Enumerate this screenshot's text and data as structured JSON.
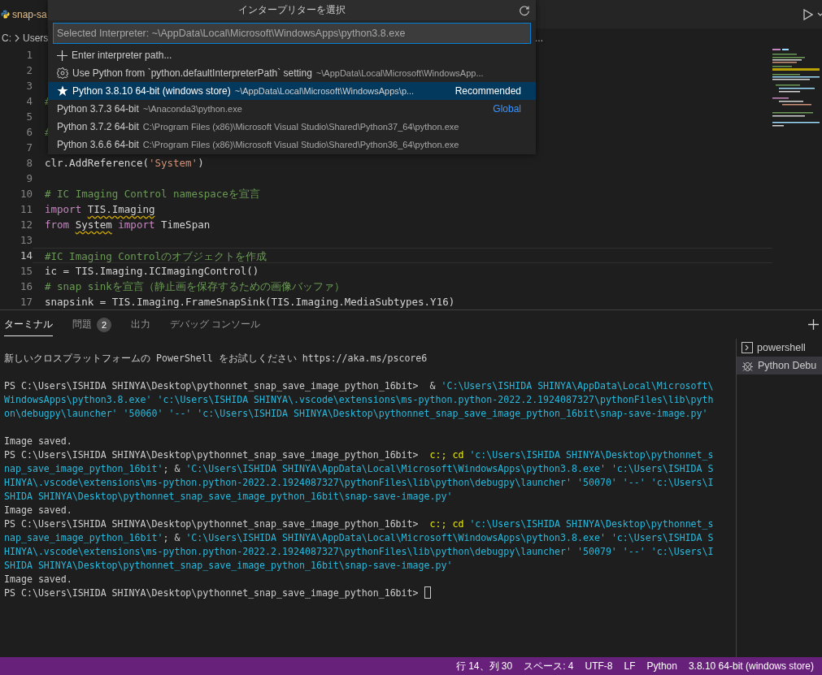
{
  "editor_tab": {
    "label": "snap-sa"
  },
  "breadcrumb": {
    "items": [
      "C:",
      "Users"
    ],
    "overflow": "..."
  },
  "code_lines": [
    {
      "number": "1",
      "current": false
    },
    {
      "number": "2",
      "current": false
    },
    {
      "number": "3",
      "current": false
    },
    {
      "number": "4",
      "current": false,
      "segments": [
        {
          "text": "#",
          "kind": "comment"
        }
      ]
    },
    {
      "number": "5",
      "current": false
    },
    {
      "number": "6",
      "current": false,
      "segments": [
        {
          "text": "#",
          "kind": "comment"
        }
      ]
    },
    {
      "number": "7",
      "current": false
    },
    {
      "number": "8",
      "current": false,
      "segments": [
        {
          "text": "clr.AddReference(",
          "kind": "plain"
        },
        {
          "text": "'System'",
          "kind": "string"
        },
        {
          "text": ")",
          "kind": "plain"
        }
      ]
    },
    {
      "number": "9",
      "current": false
    },
    {
      "number": "10",
      "current": false,
      "segments": [
        {
          "text": "# IC Imaging Control namespaceを宣言",
          "kind": "comment"
        }
      ]
    },
    {
      "number": "11",
      "current": false,
      "segments": [
        {
          "text": "import ",
          "kind": "keyword"
        },
        {
          "text": "TIS.Imaging",
          "kind": "warning"
        }
      ]
    },
    {
      "number": "12",
      "current": false,
      "segments": [
        {
          "text": "from ",
          "kind": "keyword"
        },
        {
          "text": "System",
          "kind": "warning"
        },
        {
          "text": " import",
          "kind": "keyword"
        },
        {
          "text": " TimeSpan",
          "kind": "plain"
        }
      ]
    },
    {
      "number": "13",
      "current": false
    },
    {
      "number": "14",
      "current": true,
      "segments": [
        {
          "text": "#IC Imaging Controlのオブジェクトを作成",
          "kind": "comment"
        }
      ]
    },
    {
      "number": "15",
      "current": false,
      "segments": [
        {
          "text": "ic = TIS.Imaging.ICImagingControl()",
          "kind": "plain"
        }
      ]
    },
    {
      "number": "16",
      "current": false,
      "segments": [
        {
          "text": "# snap sinkを宣言（静止画を保存するための画像バッファ）",
          "kind": "comment"
        }
      ]
    },
    {
      "number": "17",
      "current": false,
      "segments": [
        {
          "text": "snapsink = TIS.Imaging.FrameSnapSink(TIS.Imaging.MediaSubtypes.Y16)",
          "kind": "plain"
        }
      ]
    }
  ],
  "interpreter_picker": {
    "title": "インタープリターを選択",
    "placeholder": "Selected Interpreter: ~\\AppData\\Local\\Microsoft\\WindowsApps\\python3.8.exe",
    "items": [
      {
        "kind": "add",
        "label": "Enter interpreter path...",
        "selected": false
      },
      {
        "kind": "setting",
        "label": "Use Python from `python.defaultInterpreterPath` setting",
        "detail": "~\\AppData\\Local\\Microsoft\\WindowsApp...",
        "selected": false
      },
      {
        "kind": "recommended",
        "label": "Python 3.8.10 64-bit (windows store)",
        "detail": "~\\AppData\\Local\\Microsoft\\WindowsApps\\p...",
        "tag": "Recommended",
        "selected": true
      },
      {
        "kind": "interpreter",
        "label": "Python 3.7.3 64-bit",
        "detail": "~\\Anaconda3\\python.exe",
        "tag": "Global",
        "selected": false
      },
      {
        "kind": "interpreter",
        "label": "Python 3.7.2 64-bit",
        "detail": "C:\\Program Files (x86)\\Microsoft Visual Studio\\Shared\\Python37_64\\python.exe",
        "selected": false
      },
      {
        "kind": "interpreter",
        "label": "Python 3.6.6 64-bit",
        "detail": "C:\\Program Files (x86)\\Microsoft Visual Studio\\Shared\\Python36_64\\python.exe",
        "selected": false
      }
    ]
  },
  "panel_tabs": [
    {
      "label": "ターミナル",
      "selected": true
    },
    {
      "label": "問題",
      "badge": "2",
      "selected": false
    },
    {
      "label": "出力",
      "selected": false
    },
    {
      "label": "デバッグ コンソール",
      "selected": false
    }
  ],
  "terminal_blocks": [
    [
      {
        "segments": [
          {
            "text": "新しいクロスプラットフォームの PowerShell をお試しください https://aka.ms/pscore6",
            "kind": "text"
          }
        ]
      }
    ],
    [
      {
        "segments": [
          {
            "text": "PS C:\\Users\\ISHIDA SHINYA\\Desktop\\pythonnet_snap_save_image_python_16bit>  & ",
            "kind": "text"
          },
          {
            "text": "'C:\\Users\\ISHIDA SHINYA\\AppData\\Local\\Microsoft\\",
            "kind": "string"
          }
        ]
      },
      {
        "segments": [
          {
            "text": "WindowsApps\\python3.8.exe' 'c:\\Users\\ISHIDA SHINYA\\.vscode\\extensions\\ms-python.python-2022.2.1924087327\\pythonFiles\\lib\\pyth",
            "kind": "string"
          }
        ]
      },
      {
        "segments": [
          {
            "text": "on\\debugpy\\launcher' '50060' '--' 'c:\\Users\\ISHIDA SHINYA\\Desktop\\pythonnet_snap_save_image_python_16bit\\snap-save-image.py'",
            "kind": "string"
          }
        ]
      }
    ],
    [
      {
        "segments": [
          {
            "text": "Image saved.",
            "kind": "text"
          }
        ]
      },
      {
        "segments": [
          {
            "text": "PS C:\\Users\\ISHIDA SHINYA\\Desktop\\pythonnet_snap_save_image_python_16bit>  ",
            "kind": "text"
          },
          {
            "text": "c:; cd ",
            "kind": "command"
          },
          {
            "text": "'c:\\Users\\ISHIDA SHINYA\\Desktop\\pythonnet_s",
            "kind": "string"
          }
        ]
      },
      {
        "segments": [
          {
            "text": "nap_save_image_python_16bit'",
            "kind": "string"
          },
          {
            "text": "; & ",
            "kind": "text"
          },
          {
            "text": "'C:\\Users\\ISHIDA SHINYA\\AppData\\Local\\Microsoft\\WindowsApps\\python3.8.exe' 'c:\\Users\\ISHIDA S",
            "kind": "string"
          }
        ]
      },
      {
        "segments": [
          {
            "text": "HINYA\\.vscode\\extensions\\ms-python.python-2022.2.1924087327\\pythonFiles\\lib\\python\\debugpy\\launcher' '50070' '--' 'c:\\Users\\I",
            "kind": "string"
          }
        ]
      },
      {
        "segments": [
          {
            "text": "SHIDA SHINYA\\Desktop\\pythonnet_snap_save_image_python_16bit\\snap-save-image.py'",
            "kind": "string"
          }
        ]
      },
      {
        "segments": [
          {
            "text": "Image saved.",
            "kind": "text"
          }
        ]
      },
      {
        "segments": [
          {
            "text": "PS C:\\Users\\ISHIDA SHINYA\\Desktop\\pythonnet_snap_save_image_python_16bit>  ",
            "kind": "text"
          },
          {
            "text": "c:; cd ",
            "kind": "command"
          },
          {
            "text": "'c:\\Users\\ISHIDA SHINYA\\Desktop\\pythonnet_s",
            "kind": "string"
          }
        ]
      },
      {
        "segments": [
          {
            "text": "nap_save_image_python_16bit'",
            "kind": "string"
          },
          {
            "text": "; & ",
            "kind": "text"
          },
          {
            "text": "'C:\\Users\\ISHIDA SHINYA\\AppData\\Local\\Microsoft\\WindowsApps\\python3.8.exe' 'c:\\Users\\ISHIDA S",
            "kind": "string"
          }
        ]
      },
      {
        "segments": [
          {
            "text": "HINYA\\.vscode\\extensions\\ms-python.python-2022.2.1924087327\\pythonFiles\\lib\\python\\debugpy\\launcher' '50079' '--' 'c:\\Users\\I",
            "kind": "string"
          }
        ]
      },
      {
        "segments": [
          {
            "text": "SHIDA SHINYA\\Desktop\\pythonnet_snap_save_image_python_16bit\\snap-save-image.py'",
            "kind": "string"
          }
        ]
      },
      {
        "segments": [
          {
            "text": "Image saved.",
            "kind": "text"
          }
        ]
      },
      {
        "segments": [
          {
            "text": "PS C:\\Users\\ISHIDA SHINYA\\Desktop\\pythonnet_snap_save_image_python_16bit> ",
            "kind": "text"
          }
        ],
        "cursor": true
      }
    ]
  ],
  "terminals": [
    {
      "kind": "shell",
      "label": "powershell",
      "selected": false
    },
    {
      "kind": "debug",
      "label": "Python Debu",
      "selected": true
    }
  ],
  "status_bar": [
    "行 14、列 30",
    "スペース: 4",
    "UTF-8",
    "LF",
    "Python",
    "3.8.10 64-bit (windows store)"
  ]
}
